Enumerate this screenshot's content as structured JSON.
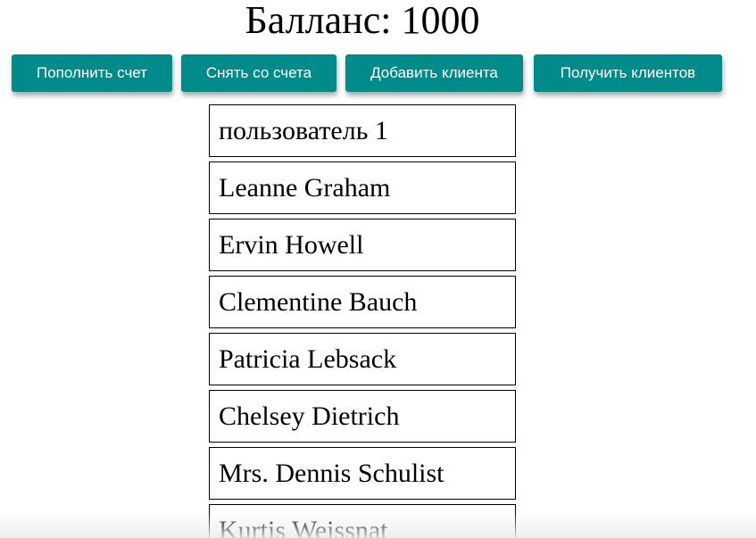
{
  "balance": {
    "title": "Балланс: 1000"
  },
  "toolbar": {
    "deposit_label": "Пополнить счет",
    "withdraw_label": "Снять со счета",
    "add_client_label": "Добавить клиента",
    "get_clients_label": "Получить клиентов"
  },
  "clients": [
    {
      "name": "пользователь 1"
    },
    {
      "name": "Leanne Graham"
    },
    {
      "name": "Ervin Howell"
    },
    {
      "name": "Clementine Bauch"
    },
    {
      "name": "Patricia Lebsack"
    },
    {
      "name": "Chelsey Dietrich"
    },
    {
      "name": "Mrs. Dennis Schulist"
    },
    {
      "name": "Kurtis Weissnat"
    }
  ],
  "colors": {
    "button_background": "#008b8b",
    "button_text": "#ffffff",
    "client_border": "#000000"
  }
}
